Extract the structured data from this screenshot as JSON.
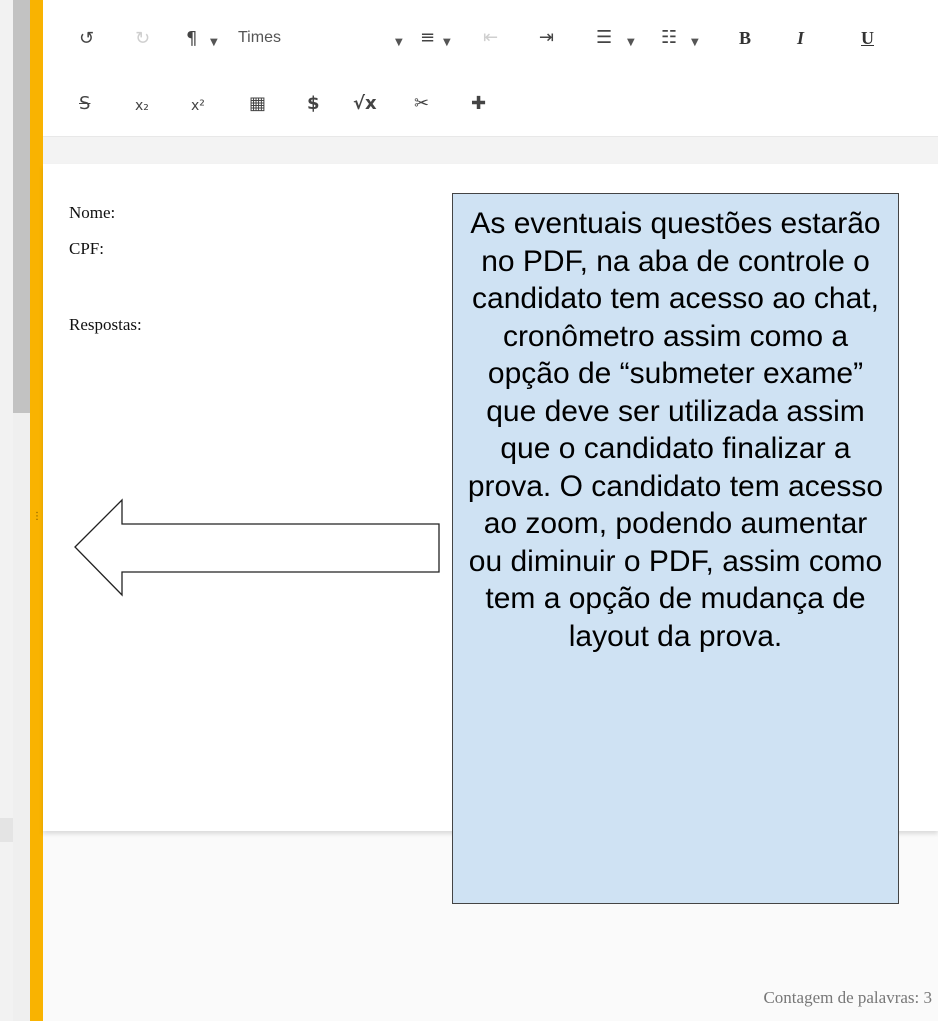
{
  "toolbar": {
    "font_name": "Times",
    "icons": {
      "undo": "↺",
      "redo": "↻",
      "paragraph": "¶",
      "align": "≡",
      "outdent": "⇤",
      "indent": "⇥",
      "numbered_list": "☰",
      "bullet_list": "☷",
      "bold": "B",
      "italic": "I",
      "underline": "U",
      "strike": "S",
      "subscript": "x₂",
      "superscript": "x²",
      "table": "▦",
      "dollar": "$",
      "sqrt": "√x",
      "scissors": "✂",
      "puzzle": "✚"
    }
  },
  "document": {
    "line_name": "Nome:",
    "line_cpf": "CPF:",
    "line_answers": "Respostas:"
  },
  "status": {
    "word_count": "Contagem de palavras: 3"
  },
  "annotation": {
    "text": "As eventuais questões estarão no PDF, na aba de controle o candidato tem acesso ao chat, cronômetro assim como a opção de “submeter exame” que deve ser utilizada assim que o candidato finalizar a prova. O candidato tem acesso ao zoom, podendo aumentar ou diminuir o PDF, assim como tem a opção de mudança de layout da prova."
  },
  "colors": {
    "splitter": "#f9b301",
    "note_background": "#cfe2f3"
  }
}
